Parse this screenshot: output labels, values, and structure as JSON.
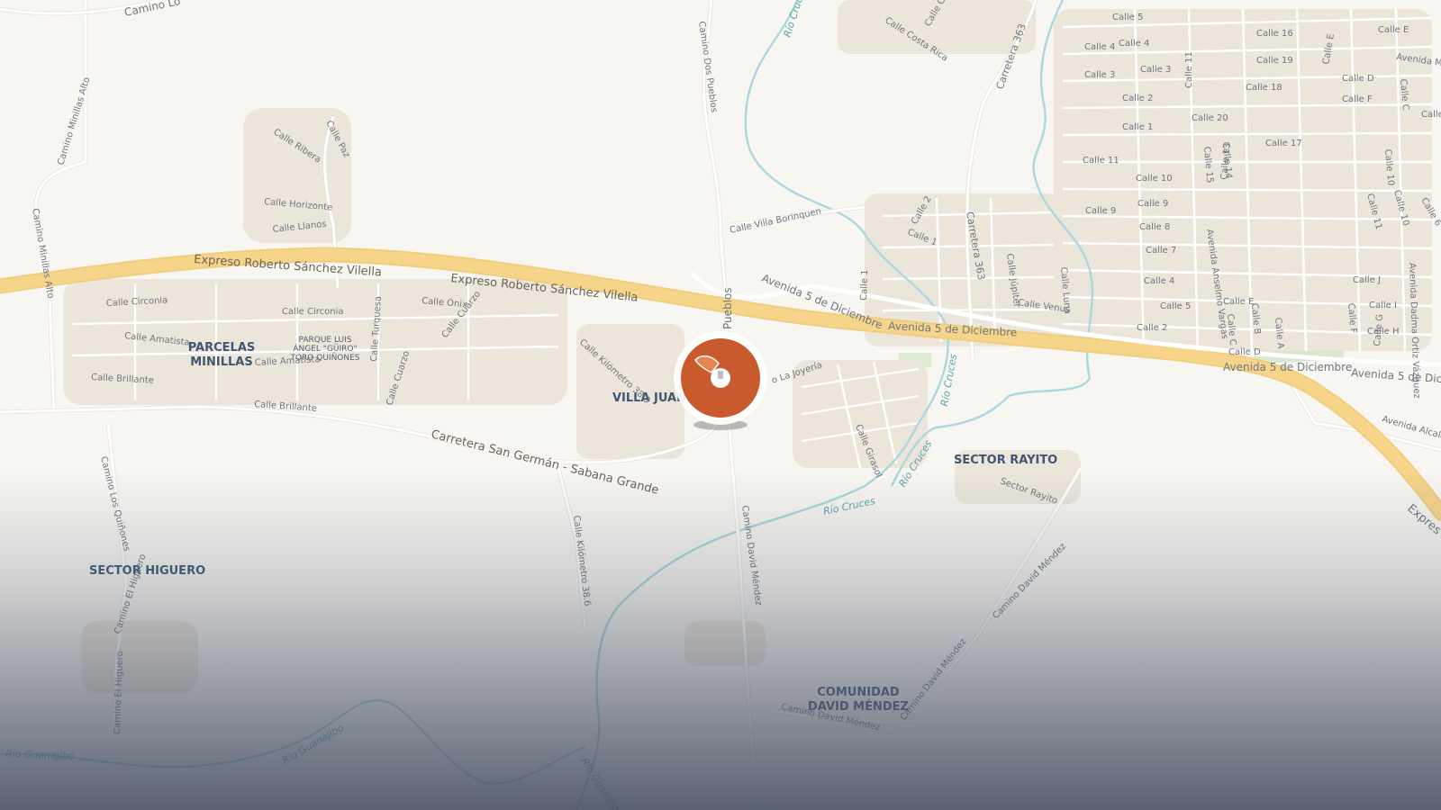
{
  "map": {
    "accent_color": "#c95a2e",
    "highway_color": "#f6d48a",
    "water_color": "#a9d8e0",
    "park_color": "#dbecd3"
  },
  "highways": [
    {
      "id": "hw1a",
      "text": "Expreso Roberto Sánchez Vilella"
    },
    {
      "id": "hw1b",
      "text": "Expreso Roberto Sánchez Vilella"
    },
    {
      "id": "av5a",
      "text": "Avenida 5 de Diciembre"
    },
    {
      "id": "av5b",
      "text": "Avenida 5 de Diciembre"
    },
    {
      "id": "av5c",
      "text": "Avenida 5 de Diciembre"
    },
    {
      "id": "av5d",
      "text": "Avenida 5 de Dicie"
    },
    {
      "id": "carr",
      "text": "Carretera San Germán - Sabana Grande"
    },
    {
      "id": "c363a",
      "text": "Carretera 363"
    },
    {
      "id": "c363b",
      "text": "Carretera 363"
    },
    {
      "id": "expr",
      "text": "Expres"
    }
  ],
  "neighborhoods": {
    "parcelas_1": "PARCELAS",
    "parcelas_2": "MINILLAS",
    "villa_juan": "VILLA JUAN",
    "sector_rayito": "SECTOR RAYITO",
    "sector_higuero": "SECTOR HIGUERO",
    "comunidad_1": "COMUNIDAD",
    "comunidad_2": "DAVID MÉNDEZ"
  },
  "parks": {
    "line1": "PARQUE LUIS",
    "line2": "ÁNGEL \"GÜIRO\"",
    "line3": "TORO QUIÑONES"
  },
  "waterways": [
    {
      "id": "w1",
      "text": "Río Cruc"
    },
    {
      "id": "w2",
      "text": "Río Cruces"
    },
    {
      "id": "w3",
      "text": "Río Cruces"
    },
    {
      "id": "w4",
      "text": "Río Cruces"
    },
    {
      "id": "w5",
      "text": "Río Guanajibo"
    },
    {
      "id": "w6",
      "text": "Río Guanajibo"
    },
    {
      "id": "w7",
      "text": "Río Guanajibo"
    }
  ],
  "streets": [
    {
      "id": "s1",
      "text": "Camino Lo"
    },
    {
      "id": "s2",
      "text": "Camino Minillas Alto"
    },
    {
      "id": "s3",
      "text": "Camino Minillas Alto"
    },
    {
      "id": "s4",
      "text": "Calle Ribera"
    },
    {
      "id": "s5",
      "text": "Calle Paz"
    },
    {
      "id": "s6",
      "text": "Calle Horizonte"
    },
    {
      "id": "s7",
      "text": "Calle Llanos"
    },
    {
      "id": "s8",
      "text": "Calle Circonia"
    },
    {
      "id": "s9",
      "text": "Calle Circonia"
    },
    {
      "id": "s10",
      "text": "Calle Amatista"
    },
    {
      "id": "s11",
      "text": "Calle Amatista"
    },
    {
      "id": "s12",
      "text": "Calle Brillante"
    },
    {
      "id": "s13",
      "text": "Calle Brillante"
    },
    {
      "id": "s14",
      "text": "Calle Ónix"
    },
    {
      "id": "s15",
      "text": "Calle Cuarzo"
    },
    {
      "id": "s16",
      "text": "Calle Turquesa"
    },
    {
      "id": "s17",
      "text": "Calle Cuarzo"
    },
    {
      "id": "s18",
      "text": "Calle Kilómetro 38.9"
    },
    {
      "id": "s19",
      "text": "Camino Dos Pueblos"
    },
    {
      "id": "s20",
      "text": "Pueblos"
    },
    {
      "id": "s21",
      "text": "Calle Villa Borinquen"
    },
    {
      "id": "s22",
      "text": "Calle Costa Rica"
    },
    {
      "id": "s23",
      "text": "Calle Ch"
    },
    {
      "id": "s24",
      "text": "Calle 2"
    },
    {
      "id": "s25",
      "text": "Calle 1"
    },
    {
      "id": "s26",
      "text": "Calle 1"
    },
    {
      "id": "s27",
      "text": "Calle Júpiter"
    },
    {
      "id": "s28",
      "text": "Calle Luna"
    },
    {
      "id": "s29",
      "text": "Calle Venus"
    },
    {
      "id": "s30",
      "text": "o La Joyería"
    },
    {
      "id": "s31",
      "text": "Calle Girasol"
    },
    {
      "id": "s32",
      "text": "Camino David Méndez"
    },
    {
      "id": "s33",
      "text": "Calle Kilómetro 38.6"
    },
    {
      "id": "s34",
      "text": "Camino Los Quiñones"
    },
    {
      "id": "s35",
      "text": "Camino El Higuero"
    },
    {
      "id": "s36",
      "text": "Camino El Higuero"
    },
    {
      "id": "s37",
      "text": "Sector Rayito"
    },
    {
      "id": "s38",
      "text": "Camino David Méndez"
    },
    {
      "id": "s39",
      "text": "Camino David Méndez"
    },
    {
      "id": "s40",
      "text": "Camino David Méndez"
    },
    {
      "id": "s41",
      "text": "Avenida Alcald"
    },
    {
      "id": "g1",
      "text": "Calle 5"
    },
    {
      "id": "g2",
      "text": "Calle 4"
    },
    {
      "id": "g3",
      "text": "Calle 4"
    },
    {
      "id": "g4",
      "text": "Calle 3"
    },
    {
      "id": "g5",
      "text": "Calle 3"
    },
    {
      "id": "g6",
      "text": "Calle 2"
    },
    {
      "id": "g7",
      "text": "Calle 1"
    },
    {
      "id": "g8",
      "text": "Calle 11"
    },
    {
      "id": "g9",
      "text": "Calle 10"
    },
    {
      "id": "g10",
      "text": "Calle 9"
    },
    {
      "id": "g11",
      "text": "Calle 9"
    },
    {
      "id": "g12",
      "text": "Calle 8"
    },
    {
      "id": "g13",
      "text": "Calle 7"
    },
    {
      "id": "g14",
      "text": "Calle 4"
    },
    {
      "id": "g15",
      "text": "Calle 5"
    },
    {
      "id": "g16",
      "text": "Calle 2"
    },
    {
      "id": "g17",
      "text": "Calle 16"
    },
    {
      "id": "g18",
      "text": "Calle 19"
    },
    {
      "id": "g19",
      "text": "Calle 18"
    },
    {
      "id": "g20",
      "text": "Calle 20"
    },
    {
      "id": "g21",
      "text": "Calle 17"
    },
    {
      "id": "g22",
      "text": "Calle 11"
    },
    {
      "id": "g23",
      "text": "Calle 15"
    },
    {
      "id": "g24",
      "text": "Calle 14"
    },
    {
      "id": "g25",
      "text": "Calle 13"
    },
    {
      "id": "g26",
      "text": "Calle E"
    },
    {
      "id": "g27",
      "text": "Calle E"
    },
    {
      "id": "g28",
      "text": "Avenida Miriam (C"
    },
    {
      "id": "g29",
      "text": "Calle D"
    },
    {
      "id": "g30",
      "text": "Calle F"
    },
    {
      "id": "g31",
      "text": "Calle C"
    },
    {
      "id": "g32",
      "text": "Calle"
    },
    {
      "id": "g33",
      "text": "Calle 10"
    },
    {
      "id": "g34",
      "text": "Calle 11"
    },
    {
      "id": "g35",
      "text": "Calle 10"
    },
    {
      "id": "g36",
      "text": "Calle 6"
    },
    {
      "id": "g37",
      "text": "Avenida Anselmo Vargas"
    },
    {
      "id": "g38",
      "text": "Calle J"
    },
    {
      "id": "g39",
      "text": "Calle I"
    },
    {
      "id": "g40",
      "text": "Calle H"
    },
    {
      "id": "g41",
      "text": "Calle G"
    },
    {
      "id": "g42",
      "text": "Calle F"
    },
    {
      "id": "g43",
      "text": "Calle E"
    },
    {
      "id": "g44",
      "text": "Calle B"
    },
    {
      "id": "g45",
      "text": "Calle C"
    },
    {
      "id": "g46",
      "text": "Calle A"
    },
    {
      "id": "g47",
      "text": "Calle D"
    },
    {
      "id": "g48",
      "text": "Avenida Dadma Ortiz Vázquez"
    }
  ],
  "marker": {
    "icon": "clipboard-pin-icon"
  }
}
